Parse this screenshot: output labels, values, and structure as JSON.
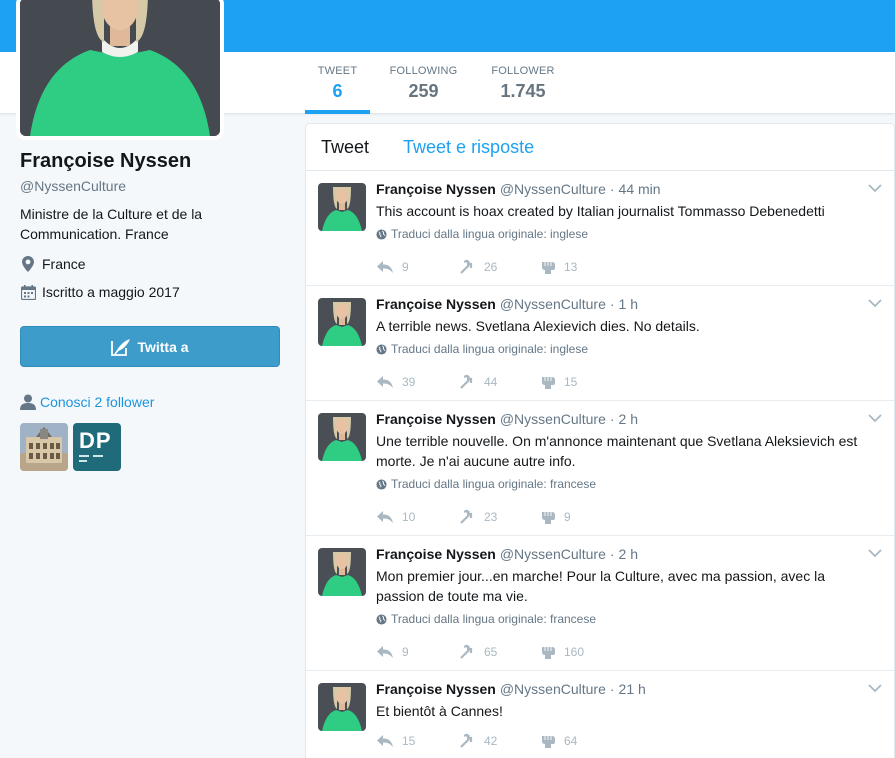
{
  "stats": [
    {
      "label": "TWEET",
      "value": "6"
    },
    {
      "label": "FOLLOWING",
      "value": "259"
    },
    {
      "label": "FOLLOWER",
      "value": "1.745"
    }
  ],
  "profile": {
    "name": "Françoise Nyssen",
    "handle": "@NyssenCulture",
    "bio": "Ministre de la Culture et de la Communication. France",
    "location": "France",
    "joined": "Iscritto a maggio 2017",
    "tweet_to_label": "Twitta a",
    "followers_you_know": "Conosci 2 follower"
  },
  "tabs": [
    "Tweet",
    "Tweet e risposte"
  ],
  "tweets": [
    {
      "name": "Françoise Nyssen",
      "handle": "@NyssenCulture",
      "time": "44 min",
      "text": "This account is hoax created by Italian journalist Tommasso Debenedetti",
      "translate": "Traduci dalla lingua originale: inglese",
      "replies": "9",
      "retweets": "26",
      "likes": "13"
    },
    {
      "name": "Françoise Nyssen",
      "handle": "@NyssenCulture",
      "time": "1 h",
      "text": "A  terrible news. Svetlana Alexievich dies. No details.",
      "translate": "Traduci dalla lingua originale: inglese",
      "replies": "39",
      "retweets": "44",
      "likes": "15"
    },
    {
      "name": "Françoise Nyssen",
      "handle": "@NyssenCulture",
      "time": "2 h",
      "text": "Une terrible nouvelle. On m'annonce maintenant que Svetlana Aleksievich est morte. Je n'ai aucune autre info.",
      "translate": "Traduci dalla lingua originale: francese",
      "replies": "10",
      "retweets": "23",
      "likes": "9"
    },
    {
      "name": "Françoise Nyssen",
      "handle": "@NyssenCulture",
      "time": "2 h",
      "text": "Mon premier jour...en marche!  Pour la Culture,  avec ma passion, avec  la passion de toute ma vie.",
      "translate": "Traduci dalla lingua originale: francese",
      "replies": "9",
      "retweets": "65",
      "likes": "160"
    },
    {
      "name": "Françoise Nyssen",
      "handle": "@NyssenCulture",
      "time": "21 h",
      "text": "Et bientôt à Cannes!",
      "translate": "",
      "replies": "15",
      "retweets": "42",
      "likes": "64"
    }
  ],
  "follower_thumbs": [
    {
      "icon": "building-photo"
    },
    {
      "label": "DP"
    }
  ],
  "colors": {
    "accent": "#1da1f2",
    "header": "#1da1f2",
    "button": "#3e9ccb",
    "link": "#1b95e0",
    "avatar_green": "#2ecc80"
  }
}
